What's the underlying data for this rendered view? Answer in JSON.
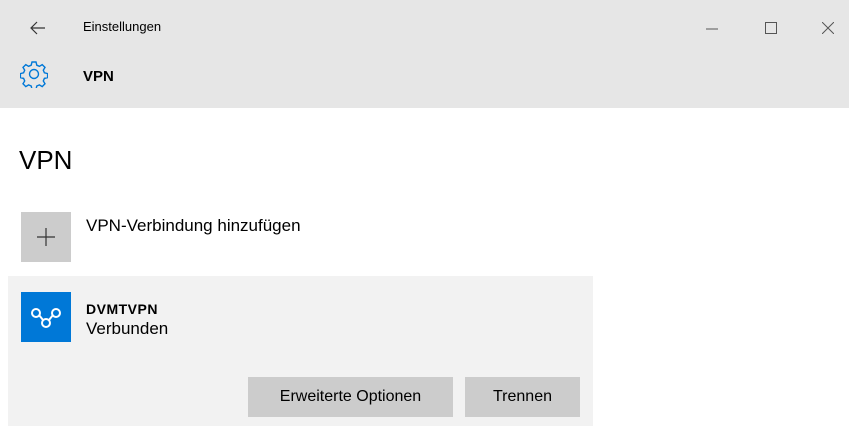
{
  "window": {
    "title": "Einstellungen",
    "minimize_glyph": "—",
    "maximize_glyph": "☐",
    "close_glyph": "✕"
  },
  "header": {
    "icon": "gear-icon",
    "title": "VPN"
  },
  "page": {
    "heading": "VPN"
  },
  "add_connection": {
    "icon": "plus-icon",
    "label": "VPN-Verbindung hinzufügen"
  },
  "connection": {
    "icon": "vpn-logo-icon",
    "name": "DVMTVPN",
    "status": "Verbunden",
    "buttons": {
      "advanced": "Erweiterte Optionen",
      "disconnect": "Trennen"
    }
  },
  "colors": {
    "titlebar": "#e6e6e6",
    "accent": "#0078d7",
    "panel": "#f2f2f2",
    "button": "#cccccc"
  }
}
